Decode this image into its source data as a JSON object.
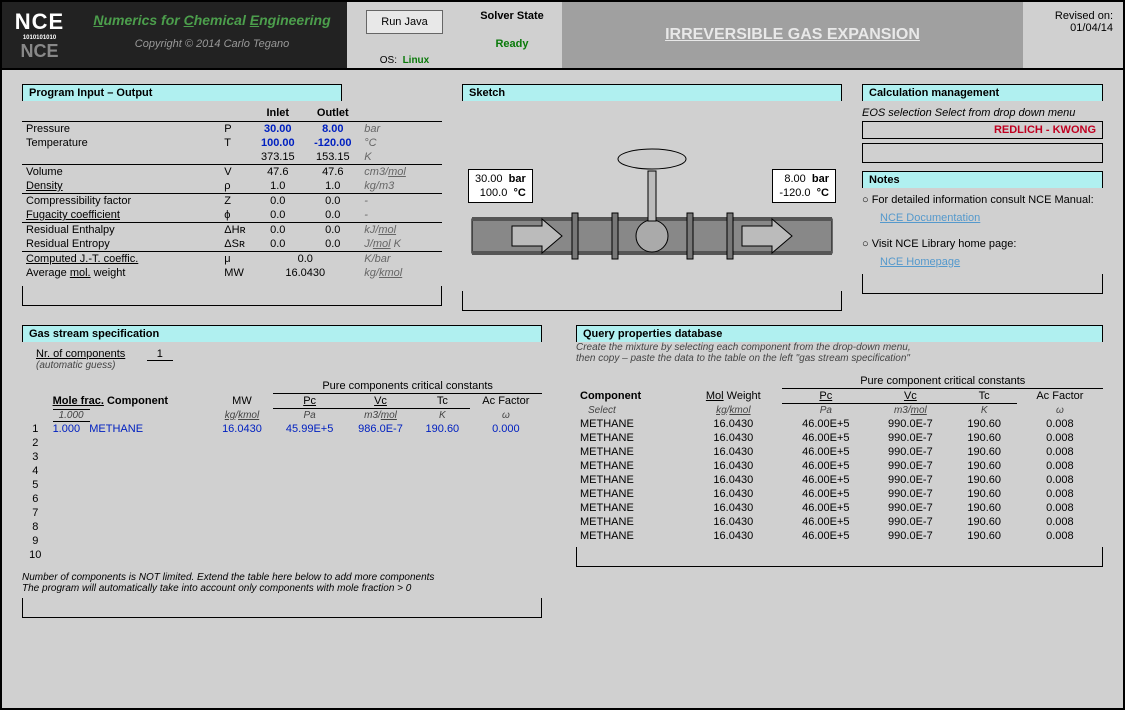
{
  "header": {
    "brand_top": "NCE",
    "brand_sub": "1010101010",
    "brand_bot": "NCE",
    "title_html": "Numerics for Chemical Engineering",
    "copyright": "Copyright © 2014 Carlo Tegano",
    "run_label": "Run Java",
    "os_label": "OS:",
    "os_value": "Linux",
    "solver_label": "Solver State",
    "solver_value": "Ready",
    "main_title": "IRREVERSIBLE GAS EXPANSION",
    "revised_label": "Revised on:",
    "revised_value": "01/04/14"
  },
  "io": {
    "head": "Program Input – Output",
    "col_inlet": "Inlet",
    "col_outlet": "Outlet",
    "rows": [
      {
        "label": "Pressure",
        "sym": "P",
        "in": "30.00",
        "out": "8.00",
        "unit": "bar",
        "input": true
      },
      {
        "label": "Temperature",
        "sym": "T",
        "in": "100.00",
        "out": "-120.00",
        "unit": "°C",
        "input": true
      },
      {
        "label": "",
        "sym": "",
        "in": "373.15",
        "out": "153.15",
        "unit": "K"
      },
      {
        "label": "Volume",
        "sym": "V",
        "in": "47.6",
        "out": "47.6",
        "unit_html": "cm3/<span class='u'>mol</span>",
        "hr": true
      },
      {
        "label": "Density",
        "u": true,
        "sym": "ρ",
        "in": "1.0",
        "out": "1.0",
        "unit": "kg/m3"
      },
      {
        "label": "Compressibility factor",
        "sym": "Z",
        "in": "0.0",
        "out": "0.0",
        "unit": "-",
        "hr": true
      },
      {
        "label": "Fugacity coefficient",
        "u": true,
        "sym": "ϕ",
        "in": "0.0",
        "out": "0.0",
        "unit": "-"
      },
      {
        "label": "Residual Enthalpy",
        "sym": "ΔHʀ",
        "in": "0.0",
        "out": "0.0",
        "unit_html": "kJ/<span class='u'>mol</span>",
        "hr": true
      },
      {
        "label": "Residual Entropy",
        "sym": "ΔSʀ",
        "in": "0.0",
        "out": "0.0",
        "unit_html": "J/<span class='u'>mol</span> K"
      }
    ],
    "jt_label": "Computed J.-T. coeffic.",
    "jt_sym": "μ",
    "jt_val": "0.0",
    "jt_unit": "K/bar",
    "mw_label": "Average mol. weight",
    "mw_sym": "MW",
    "mw_val": "16.0430",
    "mw_unit_html": "kg/<span class='u'>kmol</span>"
  },
  "sketch": {
    "head": "Sketch",
    "left_p": "30.00",
    "left_pu": "bar",
    "left_t": "100.0",
    "left_tu": "°C",
    "right_p": "8.00",
    "right_pu": "bar",
    "right_t": "-120.0",
    "right_tu": "°C"
  },
  "calc": {
    "head": "Calculation management",
    "eos_label": "EOS selection  Select from drop down menu",
    "eos_value": "REDLICH - KWONG",
    "notes_head": "Notes",
    "note1": "For detailed information consult NCE Manual:",
    "link1": "NCE Documentation",
    "note2": "Visit NCE Library home page:",
    "link2": "NCE Homepage"
  },
  "spec": {
    "head": "Gas stream specification",
    "nr_label": "Nr. of components",
    "nr_val": "1",
    "auto": "(automatic guess)",
    "crit_head": "Pure components critical constants",
    "h_mole": "Mole frac.",
    "h_comp": "Component",
    "h_mw": "MW",
    "h_pc": "Pc",
    "h_vc": "Vc",
    "h_tc": "Tc",
    "h_ac": "Ac Factor",
    "sum": "1.000",
    "u_mw": "kg/kmol",
    "u_pc": "Pa",
    "u_vc": "m3/mol",
    "u_tc": "K",
    "u_ac": "ω",
    "row": {
      "n": "1",
      "mf": "1.000",
      "name": "METHANE",
      "mw": "16.0430",
      "pc": "45.99E+5",
      "vc": "986.0E-7",
      "tc": "190.60",
      "ac": "0.000"
    },
    "empty": [
      "2",
      "3",
      "4",
      "5",
      "6",
      "7",
      "8",
      "9",
      "10"
    ],
    "foot1": "Number of components is NOT limited. Extend the table here below to add more components",
    "foot2": "The program will automatically take into account only components with mole fraction > 0"
  },
  "query": {
    "head": "Query properties database",
    "instr1": "Create the mixture by selecting each component from the drop-down menu,",
    "instr2": "then copy – paste the data to the table on the left \"gas stream specification\"",
    "crit_head": "Pure component critical constants",
    "h_comp": "Component",
    "h_mw": "Mol Weight",
    "h_pc": "Pc",
    "h_vc": "Vc",
    "h_tc": "Tc",
    "h_ac": "Ac Factor",
    "select": "Select",
    "u_mw": "kg/kmol",
    "u_pc": "Pa",
    "u_vc": "m3/mol",
    "u_tc": "K",
    "u_ac": "ω",
    "rows": [
      {
        "name": "METHANE",
        "mw": "16.0430",
        "pc": "46.00E+5",
        "vc": "990.0E-7",
        "tc": "190.60",
        "ac": "0.008"
      },
      {
        "name": "METHANE",
        "mw": "16.0430",
        "pc": "46.00E+5",
        "vc": "990.0E-7",
        "tc": "190.60",
        "ac": "0.008"
      },
      {
        "name": "METHANE",
        "mw": "16.0430",
        "pc": "46.00E+5",
        "vc": "990.0E-7",
        "tc": "190.60",
        "ac": "0.008"
      },
      {
        "name": "METHANE",
        "mw": "16.0430",
        "pc": "46.00E+5",
        "vc": "990.0E-7",
        "tc": "190.60",
        "ac": "0.008"
      },
      {
        "name": "METHANE",
        "mw": "16.0430",
        "pc": "46.00E+5",
        "vc": "990.0E-7",
        "tc": "190.60",
        "ac": "0.008"
      },
      {
        "name": "METHANE",
        "mw": "16.0430",
        "pc": "46.00E+5",
        "vc": "990.0E-7",
        "tc": "190.60",
        "ac": "0.008"
      },
      {
        "name": "METHANE",
        "mw": "16.0430",
        "pc": "46.00E+5",
        "vc": "990.0E-7",
        "tc": "190.60",
        "ac": "0.008"
      },
      {
        "name": "METHANE",
        "mw": "16.0430",
        "pc": "46.00E+5",
        "vc": "990.0E-7",
        "tc": "190.60",
        "ac": "0.008"
      },
      {
        "name": "METHANE",
        "mw": "16.0430",
        "pc": "46.00E+5",
        "vc": "990.0E-7",
        "tc": "190.60",
        "ac": "0.008"
      }
    ]
  }
}
